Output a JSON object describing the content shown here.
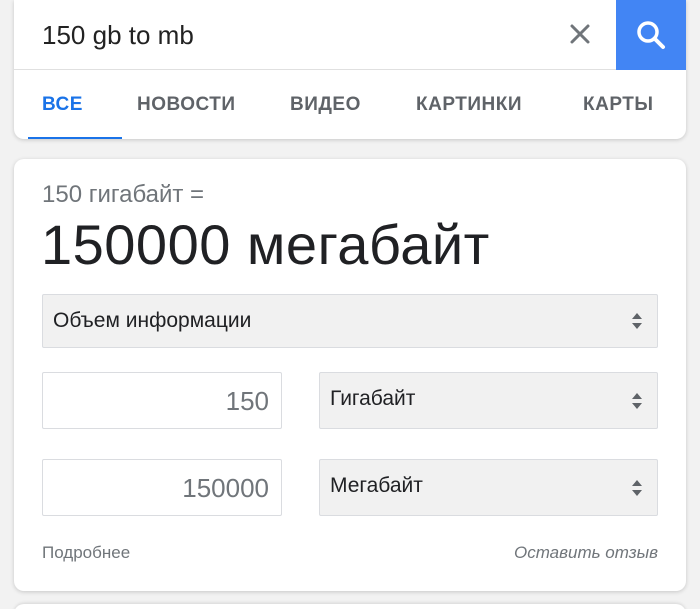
{
  "search": {
    "query": "150 gb to mb",
    "clear_icon": "close-icon",
    "search_icon": "search-icon",
    "accent_color": "#4285f4"
  },
  "tabs": [
    {
      "label": "ВСЕ",
      "active": true
    },
    {
      "label": "НОВОСТИ",
      "active": false
    },
    {
      "label": "ВИДЕО",
      "active": false
    },
    {
      "label": "КАРТИНКИ",
      "active": false
    },
    {
      "label": "КАРТЫ",
      "active": false
    }
  ],
  "converter": {
    "from_label": "150 гигабайт =",
    "result": "150000 мегабайт",
    "category": "Объем информации",
    "input_value": "150",
    "input_unit": "Гигабайт",
    "output_value": "150000",
    "output_unit": "Мегабайт",
    "more_link": "Подробнее",
    "feedback_link": "Оставить отзыв"
  }
}
